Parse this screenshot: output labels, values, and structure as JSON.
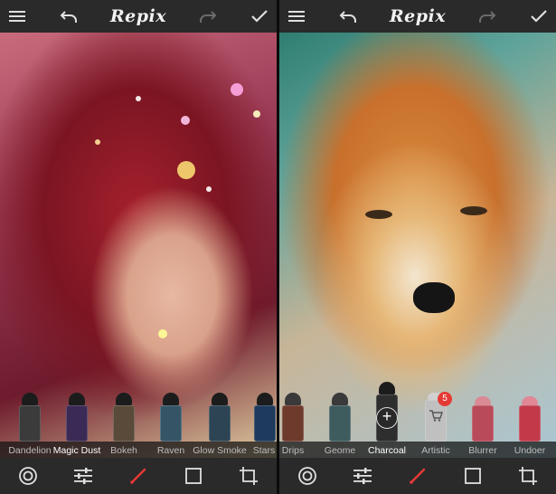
{
  "colors": {
    "toolbar": "#2a2a2a",
    "icon": "#e0e0e0",
    "icon_dim": "#8a8a8a",
    "accent_brush": "#e53935",
    "label": "#bdbdbd"
  },
  "left_panel": {
    "app_title": "Repix",
    "icons": {
      "menu": "menu-icon",
      "undo": "undo-icon",
      "redo": "redo-icon",
      "done": "checkmark-icon"
    },
    "brushes": [
      {
        "label": "Dandelion",
        "color": "#3b3b3b"
      },
      {
        "label": "Magic Dust",
        "color": "#3a2a55"
      },
      {
        "label": "Bokeh",
        "color": "#5a4a3a"
      },
      {
        "label": "Raven",
        "color": "#355566"
      },
      {
        "label": "Glow Smoke",
        "color": "#2c4453"
      },
      {
        "label": "Stars",
        "color": "#1e3a5c"
      }
    ],
    "bottom_icons": [
      "target-icon",
      "sliders-icon",
      "brush-icon",
      "frame-icon",
      "crop-icon"
    ]
  },
  "right_panel": {
    "app_title": "Repix",
    "icons": {
      "menu": "menu-icon",
      "undo": "undo-icon",
      "redo": "redo-icon",
      "done": "checkmark-icon"
    },
    "brushes": [
      {
        "label": "Drips",
        "color": "#6e3a2c"
      },
      {
        "label": "Geome",
        "color": "#3e5c5e"
      },
      {
        "label": "Charcoal",
        "color": "#2e2e2e",
        "active": true
      },
      {
        "label": "Artistic",
        "color": "#c0c0c0",
        "badge": "5"
      },
      {
        "label": "Blurrer",
        "color": "#b84a5a"
      },
      {
        "label": "Undoer",
        "color": "#c23a4a"
      }
    ],
    "bottom_icons": [
      "target-icon",
      "sliders-icon",
      "brush-icon",
      "frame-icon",
      "crop-icon"
    ]
  }
}
